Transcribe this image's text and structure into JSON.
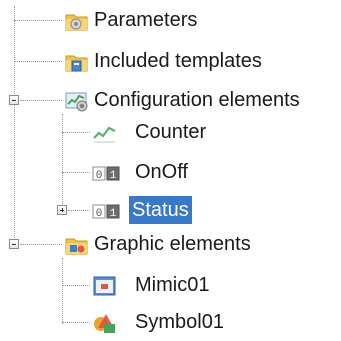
{
  "tree": {
    "items": [
      {
        "label": "Parameters",
        "icon": "folder-gear-icon",
        "expanded": null
      },
      {
        "label": "Included templates",
        "icon": "folder-template-icon",
        "expanded": null
      },
      {
        "label": "Configuration elements",
        "icon": "configuration-elements-icon",
        "expanded": true
      },
      {
        "label": "Counter",
        "icon": "counter-chart-icon",
        "expanded": null
      },
      {
        "label": "OnOff",
        "icon": "binary-01-icon",
        "expanded": null
      },
      {
        "label": "Status",
        "icon": "binary-01-icon",
        "expanded": false,
        "selected": true
      },
      {
        "label": "Graphic elements",
        "icon": "folder-graphics-icon",
        "expanded": true
      },
      {
        "label": "Mimic01",
        "icon": "mimic-icon",
        "expanded": null
      },
      {
        "label": "Symbol01",
        "icon": "symbol-shapes-icon",
        "expanded": null
      }
    ]
  },
  "colors": {
    "selection": "#3a78c8",
    "connector": "#9a9a9a"
  }
}
